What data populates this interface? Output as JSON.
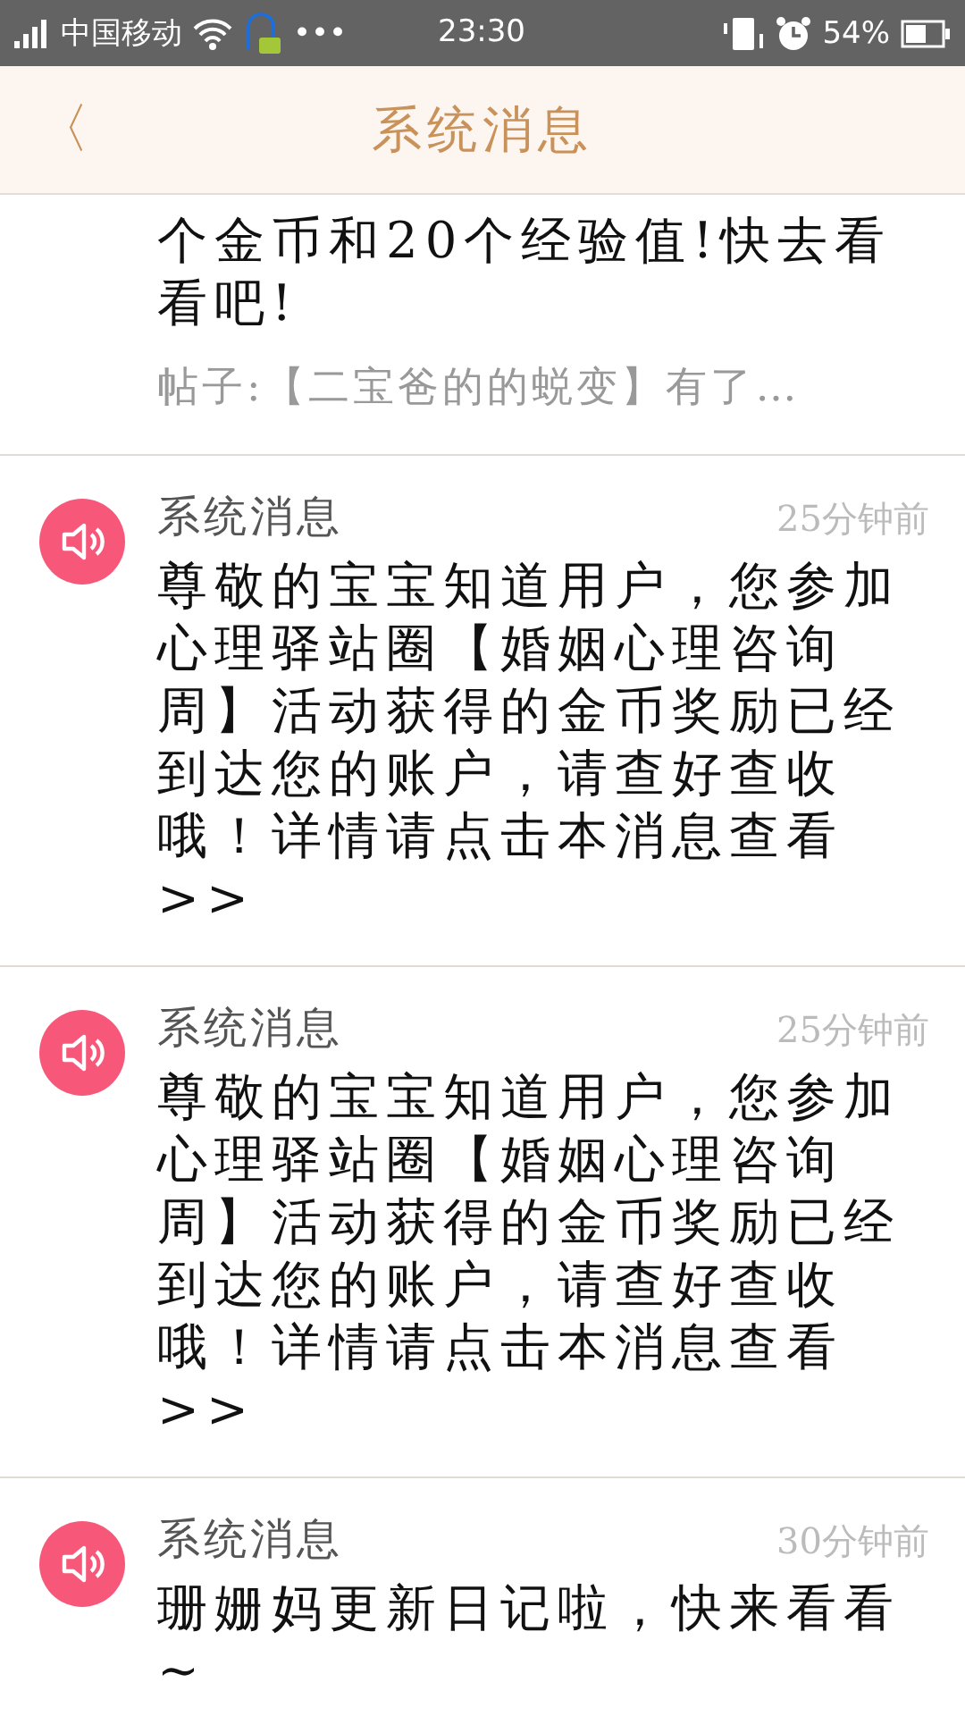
{
  "status_bar": {
    "carrier": "中国移动",
    "more": "•••",
    "time": "23:30",
    "battery": "54%"
  },
  "header": {
    "back": "〈",
    "title": "系统消息"
  },
  "partial_message": {
    "body": "个金币和20个经验值!快去看看吧!",
    "post": "帖子:【二宝爸的的蜕变】有了…"
  },
  "messages": [
    {
      "title": "系统消息",
      "time": "25分钟前",
      "body": "尊敬的宝宝知道用户，您参加心理驿站圈【婚姻心理咨询周】活动获得的金币奖励已经到达您的账户，请查好查收哦！详情请点击本消息查看>>"
    },
    {
      "title": "系统消息",
      "time": "25分钟前",
      "body": "尊敬的宝宝知道用户，您参加心理驿站圈【婚姻心理咨询周】活动获得的金币奖励已经到达您的账户，请查好查收哦！详情请点击本消息查看>>"
    },
    {
      "title": "系统消息",
      "time": "30分钟前",
      "body": "珊姗妈更新日记啦，快来看看~"
    }
  ]
}
